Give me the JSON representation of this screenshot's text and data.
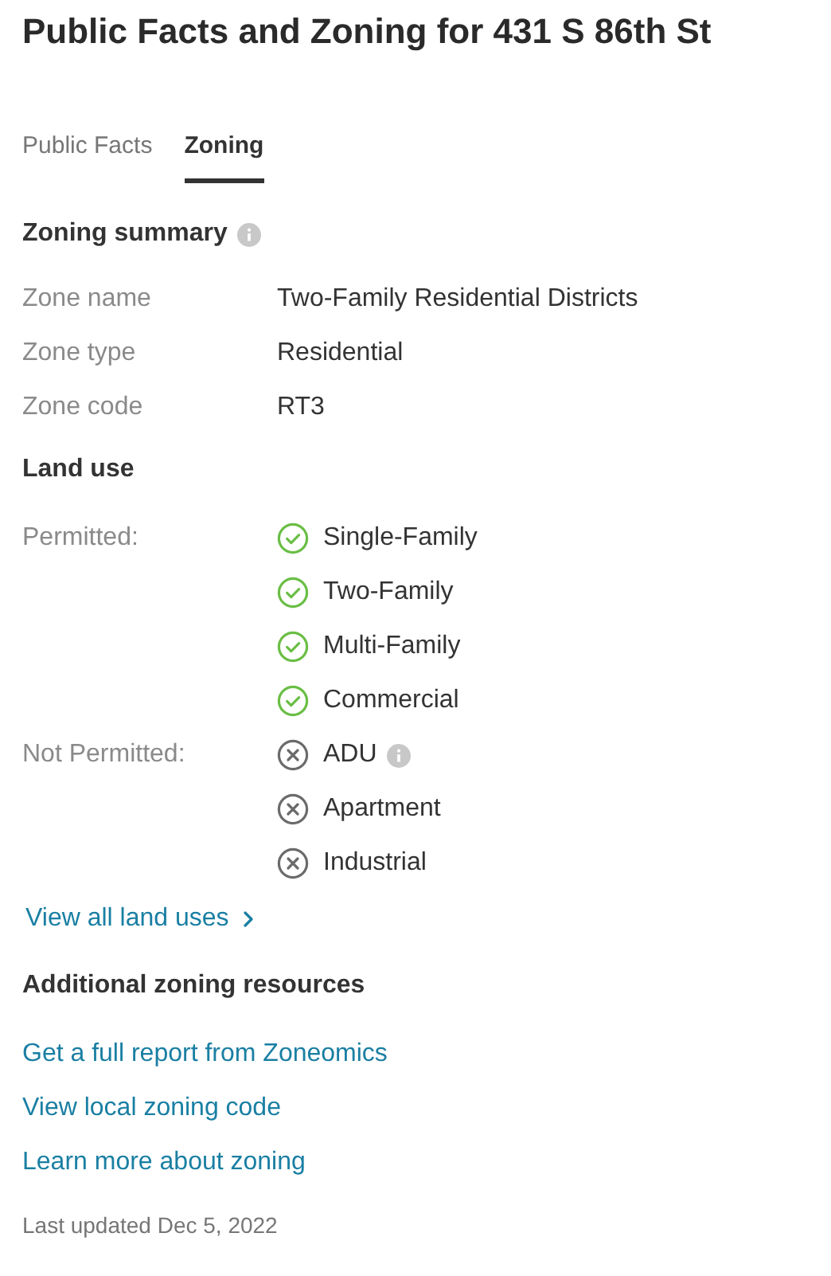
{
  "title": "Public Facts and Zoning for 431 S 86th St",
  "tabs": [
    {
      "label": "Public Facts",
      "selected": false
    },
    {
      "label": "Zoning",
      "selected": true
    }
  ],
  "summary": {
    "heading": "Zoning summary",
    "info": true,
    "rows": [
      {
        "label": "Zone name",
        "value": "Two-Family Residential Districts"
      },
      {
        "label": "Zone type",
        "value": "Residential"
      },
      {
        "label": "Zone code",
        "value": "RT3"
      }
    ]
  },
  "land_use": {
    "heading": "Land use",
    "groups": [
      {
        "label": "Permitted:",
        "items": [
          {
            "label": "Single-Family",
            "permitted": true,
            "info": false
          },
          {
            "label": "Two-Family",
            "permitted": true,
            "info": false
          },
          {
            "label": "Multi-Family",
            "permitted": true,
            "info": false
          },
          {
            "label": "Commercial",
            "permitted": true,
            "info": false
          }
        ]
      },
      {
        "label": "Not Permitted:",
        "items": [
          {
            "label": "ADU",
            "permitted": false,
            "info": true
          },
          {
            "label": "Apartment",
            "permitted": false,
            "info": false
          },
          {
            "label": "Industrial",
            "permitted": false,
            "info": false
          }
        ]
      }
    ],
    "link": "View all land uses"
  },
  "resources": {
    "heading": "Additional zoning resources",
    "links": [
      "Get a full report from Zoneomics",
      "View local zoning code",
      "Learn more about zoning"
    ]
  },
  "last_updated": "Last updated Dec 5, 2022"
}
